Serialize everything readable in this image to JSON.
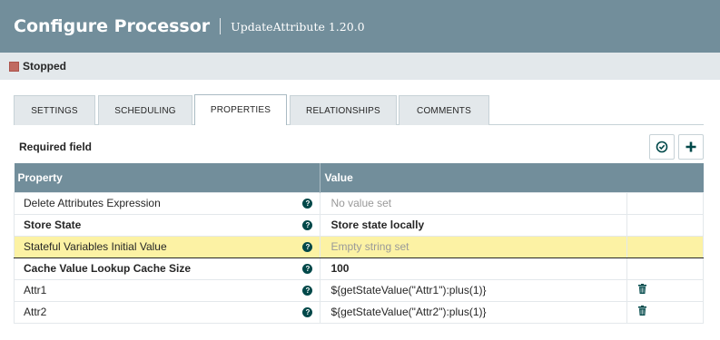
{
  "header": {
    "title": "Configure Processor",
    "subtitle": "UpdateAttribute 1.20.0"
  },
  "status": {
    "label": "Stopped",
    "color": "#ba554a"
  },
  "tabs": [
    {
      "label": "SETTINGS",
      "active": false
    },
    {
      "label": "SCHEDULING",
      "active": false
    },
    {
      "label": "PROPERTIES",
      "active": true
    },
    {
      "label": "RELATIONSHIPS",
      "active": false
    },
    {
      "label": "COMMENTS",
      "active": false
    }
  ],
  "required_label": "Required field",
  "icons": {
    "verify": "check-circle-icon",
    "add": "plus-icon",
    "help": "question-circle-icon",
    "delete": "trash-icon"
  },
  "table": {
    "headers": {
      "property": "Property",
      "value": "Value"
    },
    "rows": [
      {
        "property": "Delete Attributes Expression",
        "value": "No value set",
        "placeholder": true,
        "required": false,
        "highlighted": false,
        "deletable": false
      },
      {
        "property": "Store State",
        "value": "Store state locally",
        "placeholder": false,
        "required": true,
        "highlighted": false,
        "deletable": false
      },
      {
        "property": "Stateful Variables Initial Value",
        "value": "Empty string set",
        "placeholder": true,
        "required": false,
        "highlighted": true,
        "deletable": false
      },
      {
        "property": "Cache Value Lookup Cache Size",
        "value": "100",
        "placeholder": false,
        "required": true,
        "highlighted": false,
        "deletable": false
      },
      {
        "property": "Attr1",
        "value": "${getStateValue(\"Attr1\"):plus(1)}",
        "placeholder": false,
        "required": false,
        "highlighted": false,
        "deletable": true
      },
      {
        "property": "Attr2",
        "value": "${getStateValue(\"Attr2\"):plus(1)}",
        "placeholder": false,
        "required": false,
        "highlighted": false,
        "deletable": true
      }
    ]
  },
  "colors": {
    "header_bg": "#728e9b",
    "accent": "#004849",
    "highlight": "#fcf2a4"
  }
}
